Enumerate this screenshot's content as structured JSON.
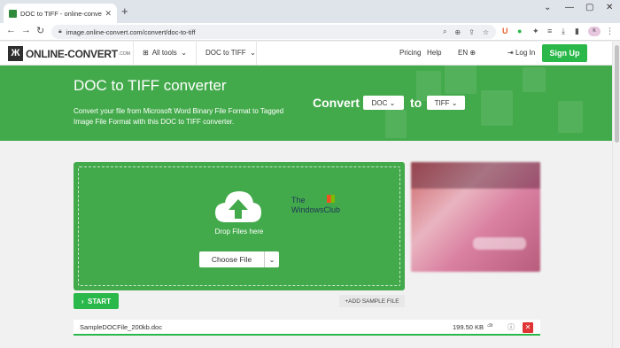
{
  "browser": {
    "tab_title": "DOC to TIFF - online-convert.co",
    "tab_close": "✕",
    "new_tab": "+",
    "url": "image.online-convert.com/convert/doc-to-tiff",
    "window_controls": [
      "⌄",
      "—",
      "▢",
      "✕"
    ],
    "profile_initials": "K"
  },
  "header": {
    "logo_text": "ONLINE-CONVERT",
    "logo_suffix": ".COM",
    "all_tools": "All tools",
    "doc_to_tiff": "DOC to TIFF",
    "pricing": "Pricing",
    "help": "Help",
    "language": "EN",
    "login": "Log In",
    "signup": "Sign Up"
  },
  "hero": {
    "title": "DOC to TIFF converter",
    "description": "Convert your file from Microsoft Word Binary File Format to Tagged Image File Format with this DOC to TIFF converter.",
    "convert_label": "Convert",
    "from_format": "DOC",
    "to_label": "to",
    "to_format": "TIFF"
  },
  "upload": {
    "drop_text": "Drop Files here",
    "choose_file": "Choose File",
    "watermark_line1": "The",
    "watermark_line2": "WindowsClub"
  },
  "actions": {
    "start": "START",
    "add_sample": "ADD SAMPLE FILE"
  },
  "file": {
    "name": "SampleDOCFile_200kb.doc",
    "size": "199.50 KB"
  }
}
